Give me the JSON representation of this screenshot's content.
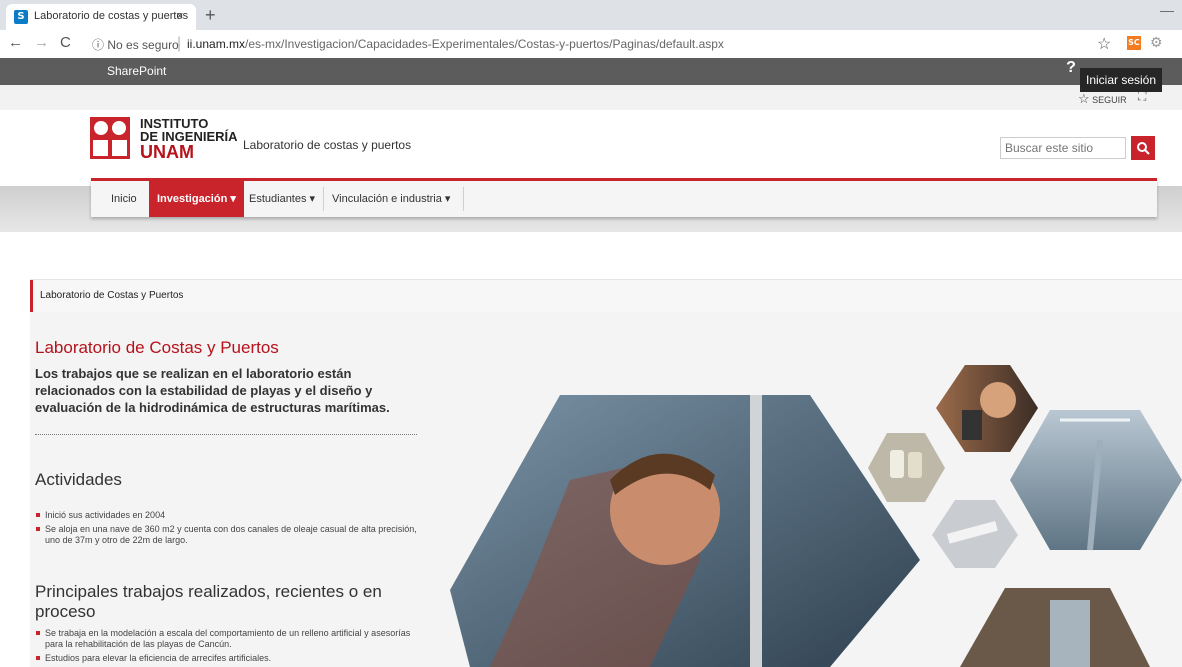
{
  "browser": {
    "tab_title": "Laboratorio de costas y puertos",
    "tab_close": "×",
    "new_tab": "+",
    "favicon": "S",
    "url_security": "No es seguro",
    "url_host": "ii.unam.mx",
    "url_path": "/es-mx/Investigacion/Capacidades-Experimentales/Costas-y-puertos/Paginas/default.aspx",
    "extension_label": "SC"
  },
  "suite_bar": {
    "brand": "SharePoint",
    "help": "?",
    "sign_in": "Iniciar sesión",
    "follow": "SEGUIR"
  },
  "header": {
    "logo_line1": "INSTITUTO",
    "logo_line2": "DE INGENIERÍA",
    "logo_line3": "UNAM",
    "site_title": "Laboratorio de costas y puertos",
    "search_placeholder": "Buscar este sitio"
  },
  "nav": {
    "items": [
      {
        "label": "Inicio"
      },
      {
        "label": "Investigación ▾"
      },
      {
        "label": "Estudiantes ▾"
      },
      {
        "label": "Vinculación e industria ▾"
      }
    ]
  },
  "breadcrumb": "Laboratorio de Costas y Puertos",
  "main": {
    "title": "Laboratorio de Costas y Puertos",
    "intro": "Los trabajos que se realizan en el laboratorio están relacionados con la estabilidad de playas y el diseño y evaluación de la hidrodinámica de estructuras marítimas.",
    "activities_heading": "Actividades",
    "activities": [
      "Inició sus actividades en  2004",
      "Se aloja en una nave de 360 m2 y cuenta con dos canales de oleaje casual de alta precisión, uno de 37m y  otro  de  22m  de  largo."
    ],
    "works_heading": "Principales trabajos realizados, recientes o en proceso",
    "works": [
      "Se trabaja en la modelación a escala del comportamiento de un relleno artificial y asesorías para la rehabilitación de las playas de Cancún.",
      "Estudios para elevar la eficiencia de arrecifes artificiales."
    ]
  },
  "colors": {
    "brand_red": "#c9242c",
    "suite_bar": "#5c5c5c"
  }
}
